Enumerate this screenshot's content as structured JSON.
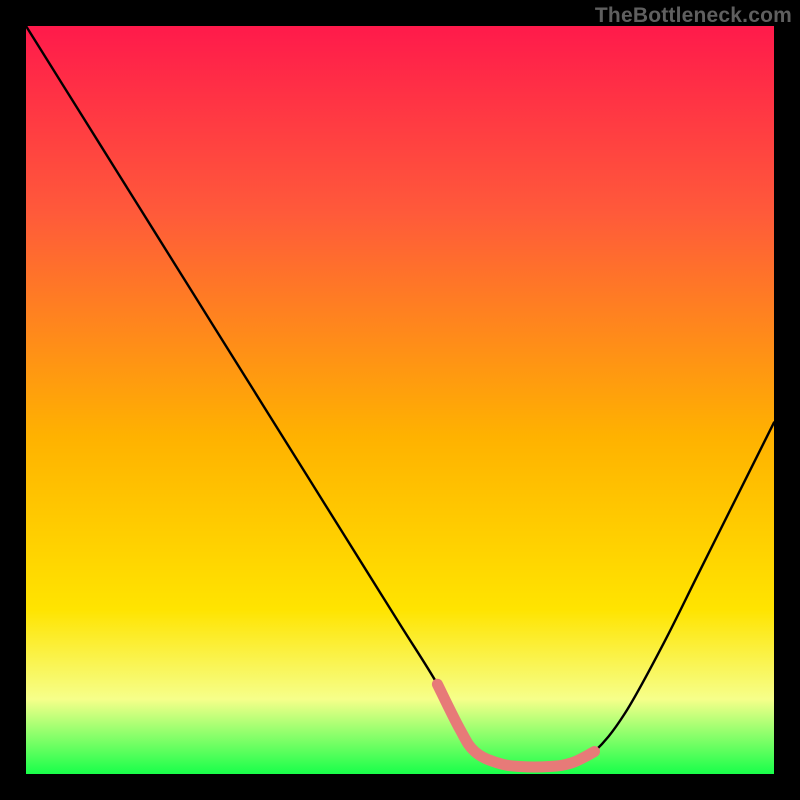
{
  "watermark": {
    "text": "TheBottleneck.com"
  },
  "colors": {
    "gradient_top": "#ff1a4b",
    "gradient_upper": "#ff5a3a",
    "gradient_mid": "#ffb200",
    "gradient_lower": "#ffe400",
    "gradient_pale": "#f6ff8a",
    "gradient_bottom": "#18ff4a",
    "curve": "#000000",
    "highlight": "#e77a78"
  },
  "chart_data": {
    "type": "line",
    "title": "",
    "xlabel": "",
    "ylabel": "",
    "xlim": [
      0,
      100
    ],
    "ylim": [
      0,
      100
    ],
    "series": [
      {
        "name": "bottleneck-curve",
        "x": [
          0,
          5,
          10,
          15,
          20,
          25,
          30,
          35,
          40,
          45,
          50,
          55,
          58,
          60,
          63,
          66,
          70,
          73,
          76,
          80,
          85,
          90,
          95,
          100
        ],
        "values": [
          100,
          92,
          84,
          76,
          68,
          60,
          52,
          44,
          36,
          28,
          20,
          12,
          6,
          3,
          1.5,
          1,
          1,
          1.5,
          3,
          8,
          17,
          27,
          37,
          47
        ]
      }
    ],
    "highlight_band": {
      "name": "optimal-range",
      "x": [
        55,
        58,
        60,
        63,
        66,
        70,
        73,
        76
      ],
      "values": [
        12,
        6,
        3,
        1.5,
        1,
        1,
        1.5,
        3
      ]
    }
  }
}
